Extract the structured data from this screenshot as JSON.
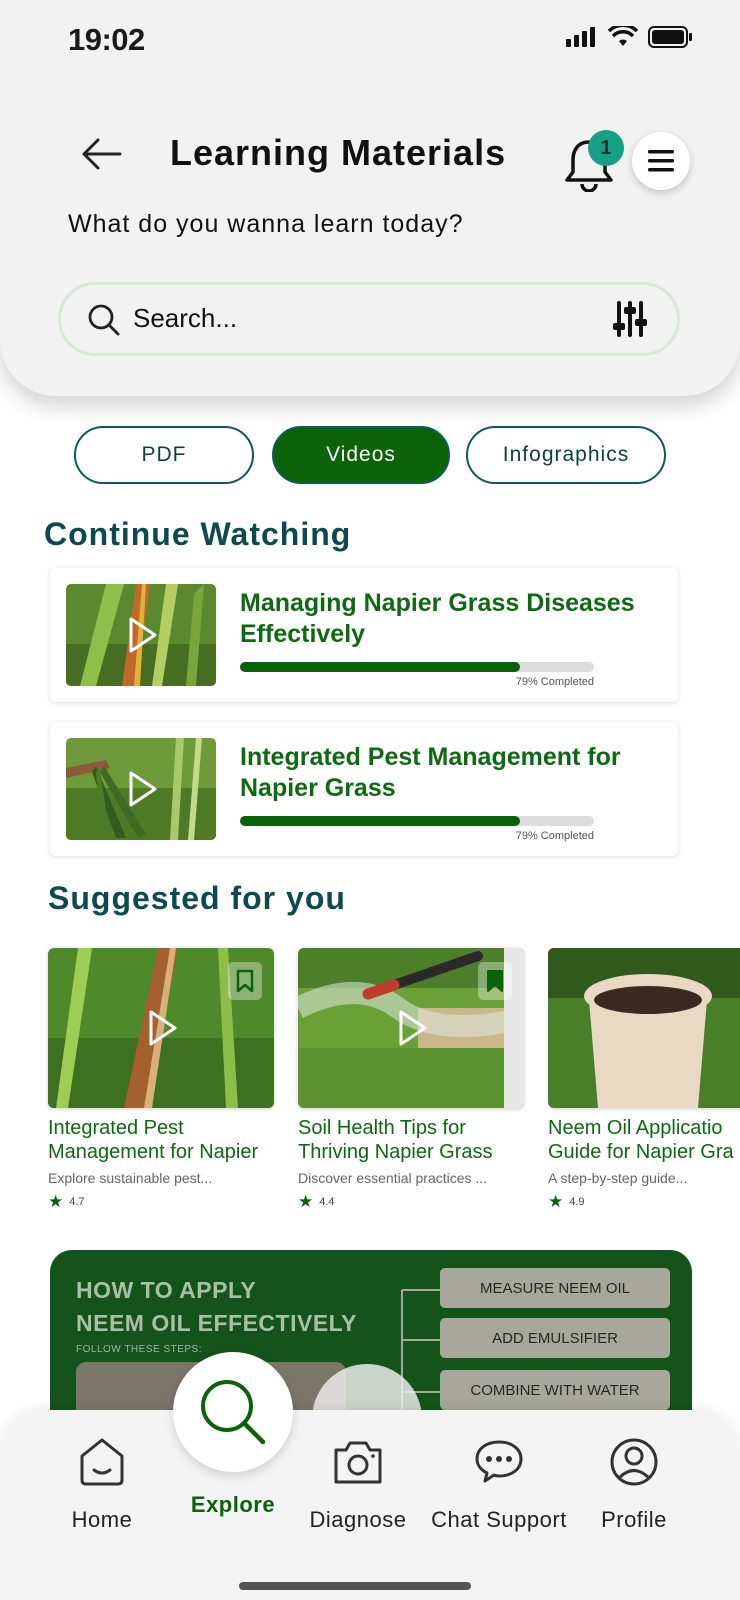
{
  "status_bar": {
    "time": "19:02"
  },
  "header": {
    "title": "Learning Materials",
    "subtitle": "What do you wanna learn today?",
    "notification_count": "1",
    "search_placeholder": "Search..."
  },
  "tabs": [
    {
      "label": "PDF",
      "active": false
    },
    {
      "label": "Videos",
      "active": true
    },
    {
      "label": "Infographics",
      "active": false
    }
  ],
  "continue_watching": {
    "heading": "Continue Watching",
    "items": [
      {
        "title": "Managing Napier Grass Diseases Effectively",
        "progress": 0.79,
        "progress_label": "79% Completed"
      },
      {
        "title": "Integrated Pest Management for Napier Grass",
        "progress": 0.79,
        "progress_label": "79% Completed"
      }
    ]
  },
  "suggested": {
    "heading": "Suggested for you",
    "items": [
      {
        "title_line1": "Integrated Pest",
        "title_line2": "Management for Napier",
        "desc": "Explore sustainable pest...",
        "rating": "4.7",
        "bookmarked": false
      },
      {
        "title_line1": "Soil Health Tips for",
        "title_line2": "Thriving Napier Grass",
        "desc": "Discover essential practices ...",
        "rating": "4.4",
        "bookmarked": true
      },
      {
        "title_line1": "Neem Oil Applicatio",
        "title_line2": "Guide for Napier Gra",
        "desc": "A step-by-step guide...",
        "rating": "4.9",
        "bookmarked": false
      }
    ]
  },
  "infographic": {
    "title_line1": "HOW TO APPLY",
    "title_line2": "NEEM OIL EFFECTIVELY",
    "caption": "FOLLOW THESE STEPS:",
    "steps": [
      "MEASURE NEEM OIL",
      "ADD EMULSIFIER",
      "COMBINE WITH WATER"
    ]
  },
  "bottom_nav": {
    "items": [
      {
        "label": "Home",
        "icon": "home-icon"
      },
      {
        "label": "Explore",
        "icon": "search-icon",
        "active": true
      },
      {
        "label": "Diagnose",
        "icon": "camera-icon"
      },
      {
        "label": "Chat Support",
        "icon": "chat-icon"
      },
      {
        "label": "Profile",
        "icon": "profile-icon"
      }
    ]
  },
  "colors": {
    "primary_green": "#0a6308",
    "heading_teal": "#0d4a4f",
    "badge": "#16a085"
  }
}
